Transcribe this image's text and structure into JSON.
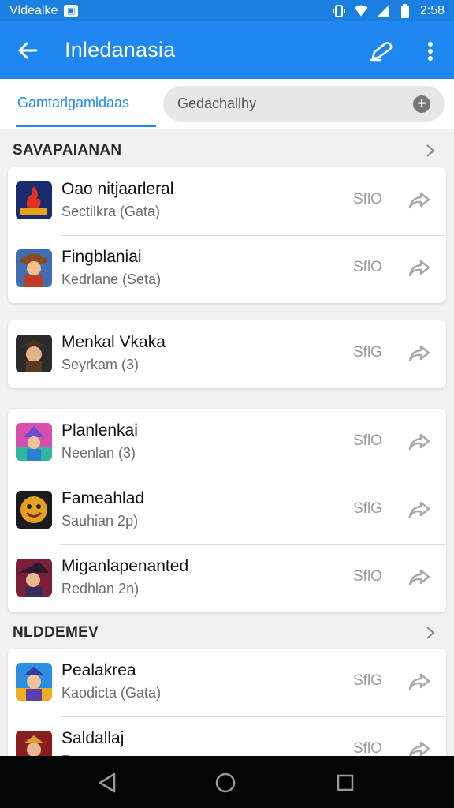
{
  "status_bar": {
    "app_text": "Vldealke",
    "time": "2:58",
    "icons": [
      "vibrate-icon",
      "wifi-icon",
      "signal-icon",
      "battery-icon"
    ]
  },
  "app_bar": {
    "title": "Inledanasia",
    "icons": [
      "back-arrow-icon",
      "edit-pencil-icon",
      "more-vert-icon"
    ]
  },
  "tabs": {
    "active_label": "Gamtarlgamldaas",
    "search_text": "Gedachallhy"
  },
  "sections": [
    {
      "title": "SAVAPAIANAN"
    },
    {
      "title": "NLDDEMEV"
    }
  ],
  "items": [
    {
      "name": "Oao nitjaarleral",
      "sub": "Sectilkra (Gata)",
      "size": "SflO",
      "icon": "flame-game-icon"
    },
    {
      "name": "Fingblaniai",
      "sub": "Kedrlane (Seta)",
      "size": "SflO",
      "icon": "cowboy-character-icon"
    },
    {
      "name": "Menkal Vkaka",
      "sub": "Seyrkam (3)",
      "size": "SflG",
      "icon": "pirate-character-icon"
    },
    {
      "name": "Planlenkai",
      "sub": "Neenlan (3)",
      "size": "SflO",
      "icon": "wizard-character-icon"
    },
    {
      "name": "Fameahlad",
      "sub": "Sauhian 2p)",
      "size": "SflG",
      "icon": "smiley-character-icon"
    },
    {
      "name": "Miganlapenanted",
      "sub": "Redhlan 2n)",
      "size": "SflO",
      "icon": "witch-character-icon"
    },
    {
      "name": "Pealakrea",
      "sub": "Kaodicta (Gata)",
      "size": "SflG",
      "icon": "blue-hero-icon"
    },
    {
      "name": "Saldallaj",
      "sub": "Ra",
      "size": "SflO",
      "icon": "knight-character-icon"
    }
  ],
  "colors": {
    "accent": "#1e88f0",
    "status": "#1a7fe0",
    "nav": "#050505"
  }
}
